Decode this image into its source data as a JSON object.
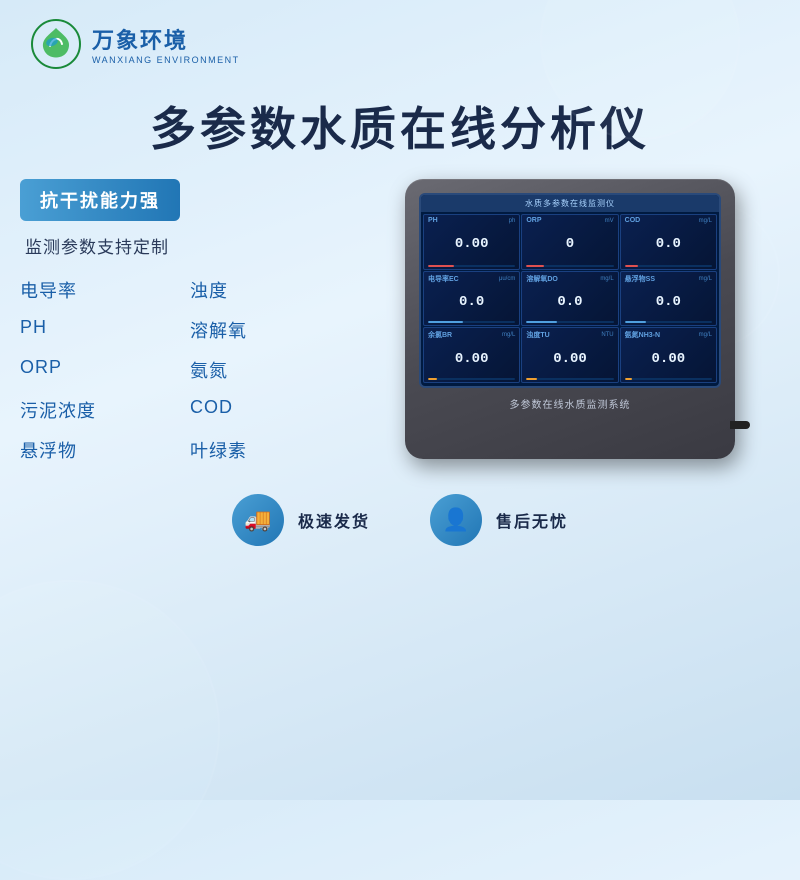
{
  "header": {
    "logo_cn": "万象环境",
    "logo_en": "WANXIANG ENVIRONMENT"
  },
  "main_title": "多参数水质在线分析仪",
  "left": {
    "highlight": "抗干扰能力强",
    "subtext": "监测参数支持定制",
    "features": [
      "电导率",
      "浊度",
      "PH",
      "溶解氧",
      "ORP",
      "氨氮",
      "污泥浓度",
      "COD",
      "悬浮物",
      "叶绿素"
    ]
  },
  "device": {
    "screen_title": "水质多参数在线监测仪",
    "label": "多参数在线水质监测系统",
    "cells": [
      {
        "param": "PH",
        "unit": "ph",
        "value": "0.00",
        "bar": 30,
        "color": "#e05050"
      },
      {
        "param": "ORP",
        "unit": "mV",
        "value": "0",
        "bar": 20,
        "color": "#e05050"
      },
      {
        "param": "COD",
        "unit": "mg/L",
        "value": "0.0",
        "bar": 15,
        "color": "#e05050"
      },
      {
        "param": "电导率EC",
        "unit": "μu/cm",
        "value": "0.0",
        "bar": 40,
        "color": "#50a0e0"
      },
      {
        "param": "溶解氧DO",
        "unit": "mg/L",
        "value": "0.0",
        "bar": 35,
        "color": "#50a0e0"
      },
      {
        "param": "悬浮物SS",
        "unit": "mg/L",
        "value": "0.0",
        "bar": 25,
        "color": "#50a0e0"
      },
      {
        "param": "余氯BR",
        "unit": "mg/L",
        "value": "0.00",
        "bar": 10,
        "color": "#f0a030"
      },
      {
        "param": "浊度TU",
        "unit": "NTU",
        "value": "0.00",
        "bar": 12,
        "color": "#f0a030"
      },
      {
        "param": "氨氮NH3-N",
        "unit": "mg/L",
        "value": "0.00",
        "bar": 8,
        "color": "#f0a030"
      }
    ]
  },
  "bottom": [
    {
      "icon": "🚚",
      "text": "极速发货"
    },
    {
      "icon": "👤",
      "text": "售后无忧"
    }
  ]
}
